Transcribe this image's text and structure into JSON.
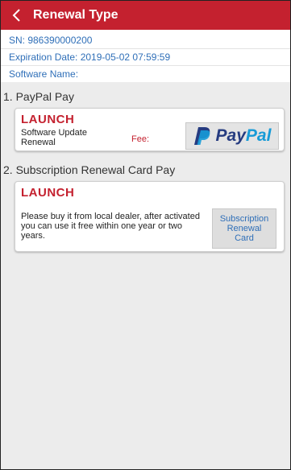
{
  "header": {
    "title": "Renewal Type"
  },
  "info": {
    "sn": "SN: 986390000200",
    "expiration": "Expiration Date: 2019-05-02 07:59:59",
    "software_name": "Software Name:"
  },
  "paypal_section": {
    "title": "1. PayPal Pay",
    "brand": "LAUNCH",
    "item_label": "Software Update\nRenewal",
    "fee_label": "Fee:",
    "button_pay": "Pay",
    "button_pal": "Pal",
    "icon": "paypal-logo"
  },
  "card_section": {
    "title": "2. Subscription Renewal Card Pay",
    "brand": "LAUNCH",
    "description": "Please buy it from local dealer, after activated you can use it free within one year or two years.",
    "button_label": "Subscription\nRenewal\nCard"
  },
  "colors": {
    "header": "#c4212f",
    "info_text": "#2f6fb8",
    "brand": "#c4212f",
    "paypal_dark": "#253b80",
    "paypal_light": "#179bd7"
  }
}
